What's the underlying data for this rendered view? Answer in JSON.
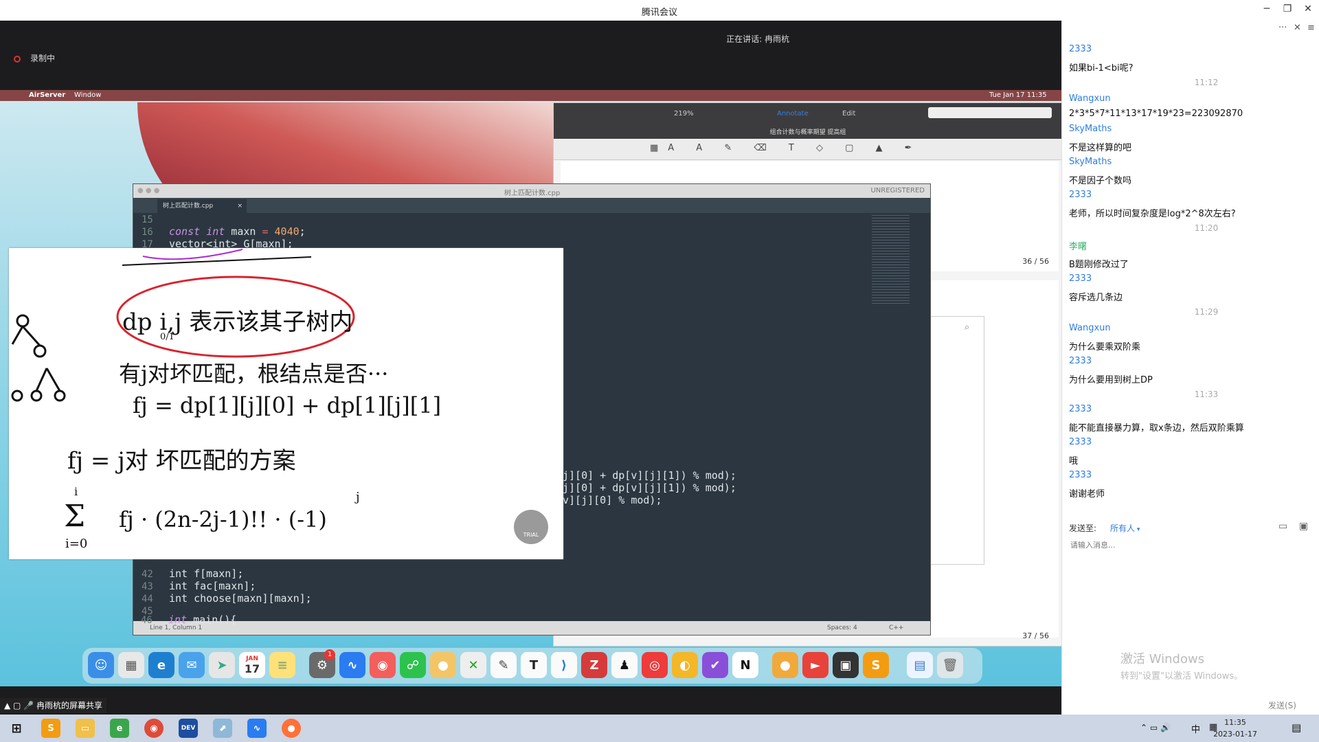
{
  "window": {
    "title": "腾讯会议",
    "speaking": "正在讲话: 冉雨杭",
    "recording": "录制中",
    "share_label": "冉雨杭的屏幕共享"
  },
  "mac": {
    "app": "AirServer",
    "menu_window": "Window",
    "datetime": "Tue Jan 17  11:35"
  },
  "pdf": {
    "zoom": "219%",
    "title": "组合计数与概率期望 提高组",
    "page_indicator_1": "36 / 56",
    "page_indicator_2": "37 / 56",
    "mode_annotate": "Annotate",
    "mode_edit": "Edit",
    "snippet": "的"
  },
  "sublime": {
    "file_title": "树上匹配计数.cpp",
    "tab": "树上匹配计数.cpp",
    "unregistered": "UNREGISTERED",
    "status_left": "Line 1, Column 1",
    "status_spaces": "Spaces: 4",
    "status_lang": "C++",
    "lines": [
      {
        "n": "15",
        "code": ""
      },
      {
        "n": "16",
        "code": "const int maxn = 4040;"
      },
      {
        "n": "17",
        "code": "vector<int> G[maxn];"
      },
      {
        "n": "",
        "code": "j][0] + dp[v][j][1]) % mod);"
      },
      {
        "n": "",
        "code": "j][0] + dp[v][j][1]) % mod);"
      },
      {
        "n": "",
        "code": "v][j][0] % mod);"
      },
      {
        "n": "42",
        "code": "int f[maxn];"
      },
      {
        "n": "43",
        "code": "int fac[maxn];"
      },
      {
        "n": "44",
        "code": "int choose[maxn][maxn];"
      },
      {
        "n": "45",
        "code": ""
      },
      {
        "n": "46",
        "code": "int main(){"
      }
    ]
  },
  "whiteboard": {
    "line1": "dp i,j 表示该其子树内",
    "line1_sub": "0/1",
    "line2": "有j对坏匹配，根结点是否···",
    "line3": "fj = dp[1][j][0] + dp[1][j][1]",
    "line4": "fj = j对 坏匹配的方案",
    "line5_sum": "Σ",
    "line5_top": "i",
    "line5_bottom": "i=0",
    "line5": "fj · (2n-2j-1)!! · (-1)",
    "line5_exp": "j",
    "trial": "TRIAL"
  },
  "chat": {
    "messages": [
      {
        "name": "2333",
        "text": "如果bi-1<bi呢?"
      },
      {
        "time": "11:12"
      },
      {
        "name": "Wangxun",
        "text": "2*3*5*7*11*13*17*19*23=223092870"
      },
      {
        "name": "SkyMaths",
        "text": "不是这样算的吧"
      },
      {
        "name": "SkyMaths",
        "text": "不是因子个数吗"
      },
      {
        "name": "2333",
        "text": "老师，所以时间复杂度是log*2^8次左右?"
      },
      {
        "time": "11:20"
      },
      {
        "name": "李曙",
        "text": "B题刚修改过了",
        "green": true
      },
      {
        "name": "2333",
        "text": "容斥选几条边"
      },
      {
        "time": "11:29"
      },
      {
        "name": "Wangxun",
        "text": "为什么要乘双阶乘"
      },
      {
        "name": "2333",
        "text": "为什么要用到树上DP"
      },
      {
        "time": "11:33"
      },
      {
        "name": "2333",
        "text": "能不能直接暴力算，取x条边，然后双阶乘算"
      },
      {
        "name": "2333",
        "text": "哦"
      },
      {
        "name": "2333",
        "text": "谢谢老师"
      }
    ],
    "send_to_label": "发送至:",
    "send_to_value": "所有人",
    "input_placeholder": "请输入消息...",
    "send_button": "发送(S)",
    "activate_title": "激活 Windows",
    "activate_sub": "转到\"设置\"以激活 Windows。"
  },
  "taskbar": {
    "time": "11:35",
    "date": "2023-01-17",
    "ime": "中"
  },
  "dock": {
    "calendar_month": "JAN",
    "calendar_day": "17",
    "badge": "1"
  }
}
